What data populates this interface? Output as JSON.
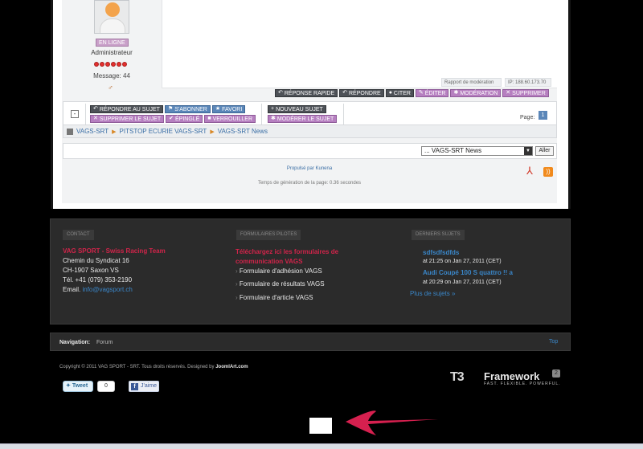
{
  "profile": {
    "status_badge": "EN LIGNE",
    "role": "Administrateur",
    "message_count": "Message: 44"
  },
  "post": {
    "report_label": "Rapport de modération",
    "ip_label": "IP: 188.60.173.70",
    "actions": {
      "quick_reply": "RÉPONSE RAPIDE",
      "reply": "RÉPONDRE",
      "quote": "CITER",
      "edit": "ÉDITER",
      "moderate": "MODÉRATION",
      "delete": "SUPPRIMER"
    }
  },
  "toolbar": {
    "collapse": "-",
    "reply_topic": "RÉPONDRE AU SUJET",
    "subscribe": "S'ABONNER",
    "favorite": "FAVORI",
    "delete_topic": "SUPPRIMER LE SUJET",
    "pin": "ÉPINGLÉ",
    "lock": "VERROUILLER",
    "new_topic": "NOUVEAU SUJET",
    "moderate_topic": "MODÉRER LE SUJET",
    "page_label": "Page:",
    "page_number": "1"
  },
  "breadcrumbs": [
    "VAGS-SRT",
    "PITSTOP ECURIE VAGS-SRT",
    "VAGS-SRT News"
  ],
  "jump": {
    "selected": "... VAGS-SRT News",
    "go_label": "Aller"
  },
  "powered_by": "Propulsé par Kunena",
  "generation_time": "Temps de génération de la page: 0.36 secondes",
  "footer": {
    "contact": {
      "heading": "CONTACT",
      "name": "VAG SPORT - Swiss Racing Team",
      "address1": "Chemin du Syndicat 16",
      "address2": "CH-1907 Saxon VS",
      "phone": "Tél. +41 (079) 353-2190",
      "email_label": "Email.",
      "email": "info@vagsport.ch"
    },
    "forms": {
      "heading": "FORMULAIRES PILOTES",
      "title": "Téléchargez ici les formulaires de communication VAGS",
      "links": [
        "Formulaire d'adhésion VAGS",
        "Formulaire de résultats VAGS",
        "Formulaire d'article VAGS"
      ]
    },
    "latest": {
      "heading": "DERNIERS SUJETS",
      "topics": [
        {
          "title": "sdfsdfsdfds",
          "meta": "at 21:25 on Jan 27, 2011 (CET)"
        },
        {
          "title": "Audi Coupé 100 S quattro !! a",
          "meta": "at 20:29 on Jan 27, 2011 (CET)"
        }
      ],
      "more": "Plus de sujets »"
    }
  },
  "navigation": {
    "label": "Navigation:",
    "item": "Forum",
    "top": "Top"
  },
  "copyright": {
    "text": "Copyright © 2011 VAG SPORT - SRT. Tous droits réservés. Designed by",
    "designer": "JoomlArt.com"
  },
  "t3": {
    "mark": "T3",
    "word": "Framework",
    "badge": "2",
    "tagline": "FAST. FLEXIBLE. POWERFUL."
  },
  "social": {
    "tweet": "Tweet",
    "tweet_count": "0",
    "like": "J'aime"
  },
  "colors": {
    "accent_red": "#d1244a",
    "link_blue": "#3a86c8",
    "button_purple": "#b67fc0",
    "button_dark": "#4d5157",
    "annotation_pink": "#d6204f"
  }
}
